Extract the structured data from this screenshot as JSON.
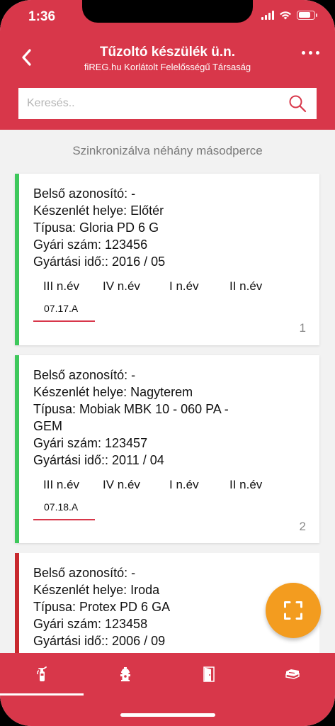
{
  "status_bar": {
    "time": "1:36",
    "battery_level": 0.8
  },
  "header": {
    "title": "Tűzoltó készülék ü.n.",
    "subtitle": "fiREG.hu Korlátolt Felelősségű Társaság",
    "back_icon": "chevron-left-icon",
    "more_icon": "more-horizontal-icon"
  },
  "search": {
    "placeholder": "Keresés..",
    "value": "",
    "icon": "search-icon"
  },
  "sync_text": "Szinkronizálva néhány másodperce",
  "cards": [
    {
      "status_color": "#3ec85c",
      "lines": [
        "Belső azonosító: -",
        "Készenlét helye: Előtér",
        "Típusa: Gloria PD 6 G",
        "Gyári szám: 123456",
        "Gyártási idő:: 2016 / 05"
      ],
      "quarters": [
        "III n.év",
        "IV n.év",
        "I n.év",
        "II n.év"
      ],
      "code": "07.17.A",
      "number": "1"
    },
    {
      "status_color": "#3ec85c",
      "lines": [
        "Belső azonosító: -",
        "Készenlét helye: Nagyterem",
        "Típusa: Mobiak MBK 10 - 060 PA -",
        "GEM",
        "Gyári szám: 123457",
        "Gyártási idő:: 2011 / 04"
      ],
      "quarters": [
        "III n.év",
        "IV n.év",
        "I n.év",
        "II n.év"
      ],
      "code": "07.18.A",
      "number": "2"
    },
    {
      "status_color": "#c8292e",
      "lines": [
        "Belső azonosító: -",
        "Készenlét helye: Iroda",
        "Típusa: Protex PD 6 GA",
        "Gyári szám: 123458",
        "Gyártási idő:: 2006 / 09"
      ]
    }
  ],
  "fab": {
    "icon": "scan-icon"
  },
  "tabbar": {
    "tabs": [
      {
        "icon": "fire-extinguisher-icon",
        "active": true
      },
      {
        "icon": "fire-hydrant-icon",
        "active": false
      },
      {
        "icon": "fire-door-icon",
        "active": false
      },
      {
        "icon": "fire-blanket-icon",
        "active": false
      }
    ]
  },
  "colors": {
    "brand_red": "#d8374a",
    "ok_green": "#3ec85c",
    "alert_red": "#c8292e",
    "fab_orange": "#f39c1f"
  }
}
